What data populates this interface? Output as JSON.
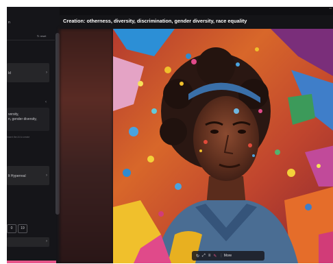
{
  "window": {
    "title": "Creation: otherness, diversity, discrimination, gender diversity, race equality",
    "corner_label": "••"
  },
  "left_panel": {
    "top_label": "n",
    "reset_label": "↻ reset",
    "row1_label": "ld",
    "prompt_line1": "versity,",
    "prompt_line2": "n, gender diversity,",
    "hint": "Insert the AI to create",
    "style_label": "lt Hyperreal",
    "num_a": "0",
    "num_b": "19"
  },
  "toolbar": {
    "icons": [
      "rotate-icon",
      "expand-icon",
      "list-icon",
      "brush-icon"
    ],
    "more_label": "⋮ More"
  },
  "colors": {
    "accent": "#e8568a",
    "panel": "#151519",
    "title_bg": "#141417"
  }
}
